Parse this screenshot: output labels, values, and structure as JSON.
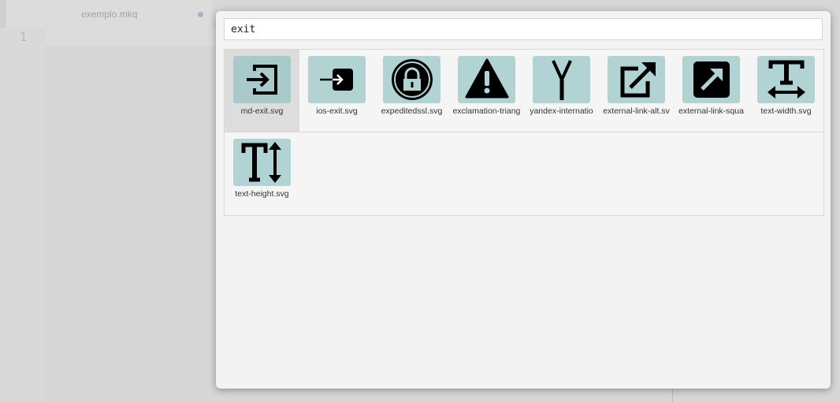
{
  "editor": {
    "tab_title": "exemplo.mkq",
    "line_number": "1"
  },
  "search": {
    "value": "exit"
  },
  "results": [
    {
      "label": "md-exit.svg",
      "icon": "md-exit-icon"
    },
    {
      "label": "ios-exit.svg",
      "icon": "ios-exit-icon"
    },
    {
      "label": "expeditedssl.svg",
      "icon": "expeditedssl-icon"
    },
    {
      "label": "exclamation-triang",
      "icon": "exclamation-triangle-icon"
    },
    {
      "label": "yandex-internatio",
      "icon": "yandex-icon"
    },
    {
      "label": "external-link-alt.sv",
      "icon": "external-link-alt-icon"
    },
    {
      "label": "external-link-squa",
      "icon": "external-link-square-icon"
    },
    {
      "label": "text-width.svg",
      "icon": "text-width-icon"
    },
    {
      "label": "text-height.svg",
      "icon": "text-height-icon"
    }
  ],
  "colors": {
    "icon_tile": "#b2d3d3",
    "selected_bg": "#dddddd",
    "modal_bg": "#f3f3f3"
  }
}
